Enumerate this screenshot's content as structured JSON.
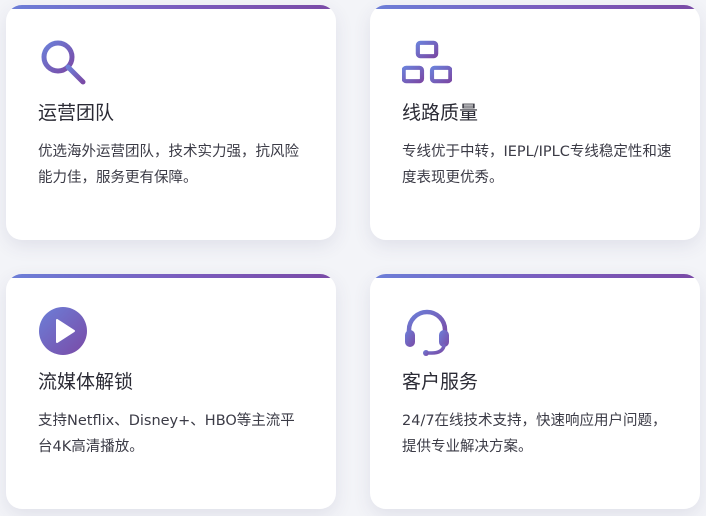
{
  "colors": {
    "accent_start": "#6c7fd8",
    "accent_end": "#7a4aa6"
  },
  "cards": [
    {
      "icon": "search-icon",
      "title": "运营团队",
      "description": "优选海外运营团队，技术实力强，抗风险能力佳，服务更有保障。"
    },
    {
      "icon": "network-icon",
      "title": "线路质量",
      "description": "专线优于中转，IEPL/IPLC专线稳定性和速度表现更优秀。"
    },
    {
      "icon": "play-icon",
      "title": "流媒体解锁",
      "description": "支持Netflix、Disney+、HBO等主流平台4K高清播放。"
    },
    {
      "icon": "headset-icon",
      "title": "客户服务",
      "description": "24/7在线技术支持，快速响应用户问题，提供专业解决方案。"
    }
  ]
}
